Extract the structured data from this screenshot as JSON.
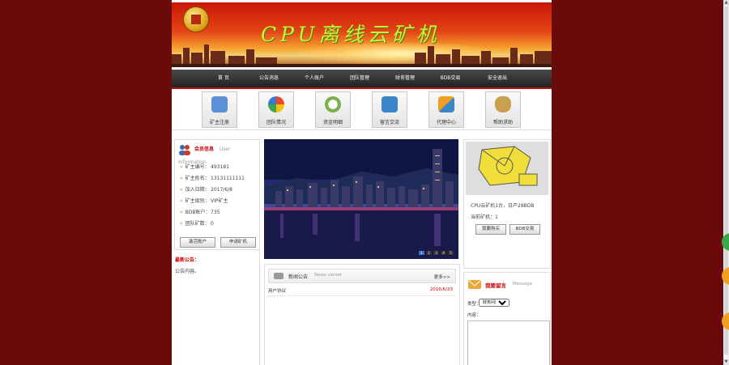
{
  "site": {
    "title": "CPU离线云矿机"
  },
  "nav": [
    "首 页",
    "公告消息",
    "个人账户",
    "团队管理",
    "财务管理",
    "BDB交易",
    "安全退出"
  ],
  "quick_links": [
    {
      "label": "矿主注册",
      "icon": "users-icon",
      "color": "#5b8fd6"
    },
    {
      "label": "团队情况",
      "icon": "team-flower-icon",
      "color": "#e84a2a"
    },
    {
      "label": "资金明细",
      "icon": "clock-money-icon",
      "color": "#7ab04a"
    },
    {
      "label": "留言交流",
      "icon": "chat-icon",
      "color": "#3a86c8"
    },
    {
      "label": "代理中心",
      "icon": "puzzle-icon",
      "color": "#f0a020"
    },
    {
      "label": "帮助求助",
      "icon": "money-bag-icon",
      "color": "#c8a050"
    }
  ],
  "member": {
    "title": "会员信息",
    "title_en": "User Information",
    "rows": [
      {
        "label": "矿主编号：",
        "value": "493181"
      },
      {
        "label": "矿主姓名：",
        "value": "13131111111"
      },
      {
        "label": "加入日期：",
        "value": "2017/6/8"
      },
      {
        "label": "矿主级别：",
        "value": "VIP矿主"
      },
      {
        "label": "BDB账户：",
        "value": "735"
      },
      {
        "label": "团队矿数：",
        "value": "0"
      }
    ],
    "btn_left": "激活账户",
    "btn_right": "申请矿机"
  },
  "notice": {
    "title": "最新公告：",
    "body": "公告内容。"
  },
  "slider": {
    "dots": [
      "1",
      "2",
      "3",
      "4",
      "5"
    ],
    "active": 0
  },
  "machine": {
    "line1": "CPU云矿机1台，日产28BDB",
    "line2": "当前矿机：1",
    "btn_left": "我要购买",
    "btn_right": "BDB交易"
  },
  "news": {
    "title": "新闻公告",
    "title_en": "News center",
    "more": "更多>>",
    "items": [
      {
        "title": "用户协议",
        "date": "2016/6/23"
      }
    ]
  },
  "message": {
    "title": "我要留言",
    "title_en": "Message",
    "topic_label": "类型：",
    "topic_value": "财务问题",
    "content_label": "内容："
  },
  "colors": {
    "background": "#6b0a0a",
    "accent": "#cc0000"
  }
}
